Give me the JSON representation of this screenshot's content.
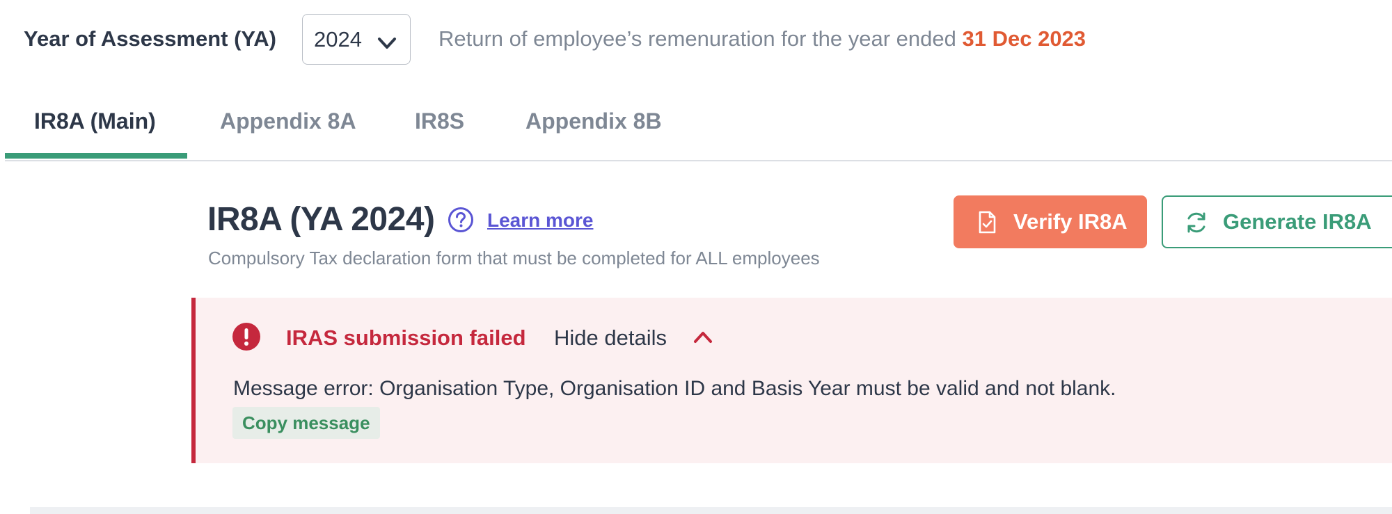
{
  "header": {
    "ya_label": "Year of Assessment (YA)",
    "ya_selected": "2024",
    "description_prefix": "Return of employee’s remenuration for the year ended",
    "description_date": "31 Dec 2023"
  },
  "tabs": [
    {
      "label": "IR8A (Main)",
      "active": true
    },
    {
      "label": "Appendix 8A",
      "active": false
    },
    {
      "label": "IR8S",
      "active": false
    },
    {
      "label": "Appendix 8B",
      "active": false
    }
  ],
  "form": {
    "title": "IR8A (YA 2024)",
    "learn_more": "Learn more",
    "subtitle": "Compulsory Tax declaration form that must be completed for ALL employees"
  },
  "actions": {
    "verify_label": "Verify IR8A",
    "generate_label": "Generate IR8A"
  },
  "error": {
    "title": "IRAS submission failed",
    "toggle_label": "Hide details",
    "message": "Message error: Organisation Type, Organisation ID and Basis Year must be valid and not blank.",
    "copy_label": "Copy message"
  },
  "icons": {
    "select_chevron": "chevron-down-icon",
    "help": "help-circle-icon",
    "verify": "file-check-icon",
    "generate": "refresh-icon",
    "error": "alert-circle-icon",
    "collapse": "chevron-up-icon"
  },
  "colors": {
    "accent_green": "#3a9c78",
    "verify_orange": "#f27b5f",
    "date_orange": "#e05a33",
    "error_red": "#c5283d",
    "error_bg": "#fcf0f1",
    "link_purple": "#5a55d4"
  }
}
